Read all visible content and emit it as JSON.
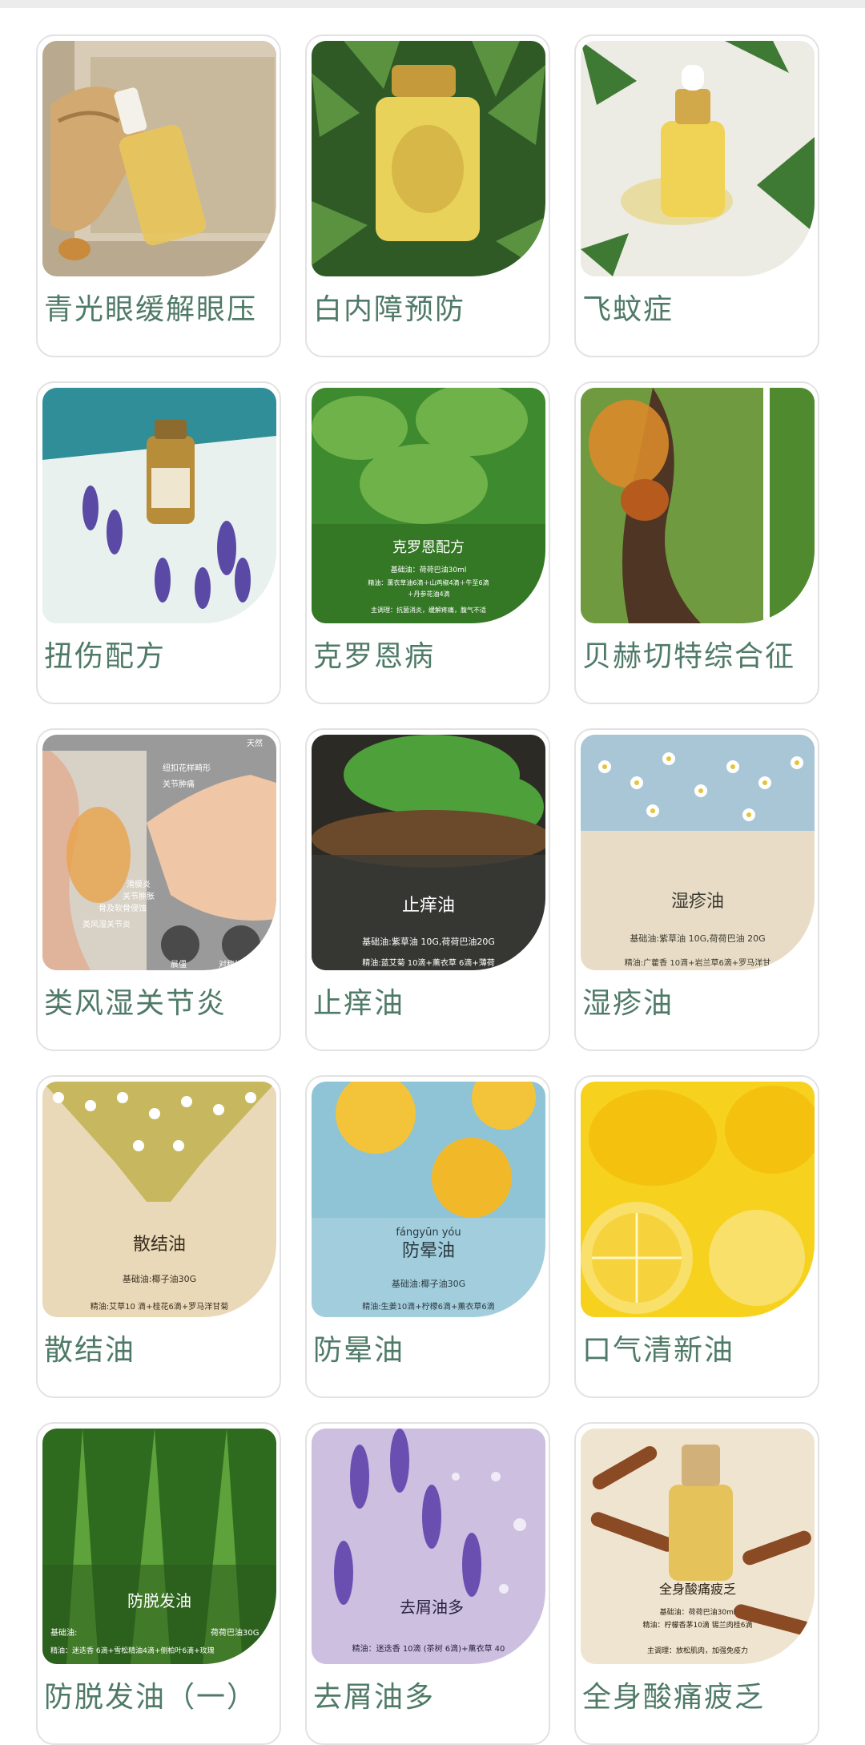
{
  "cards": [
    {
      "label": "青光眼缓解眼压",
      "icon": "ginger-oil-bottle"
    },
    {
      "label": "白内障预防",
      "icon": "gold-perfume-bottle"
    },
    {
      "label": "飞蚊症",
      "icon": "dropper-bottle"
    },
    {
      "label": "扭伤配方",
      "icon": "lavender-bottle"
    },
    {
      "label": "克罗恩病",
      "icon": "mint-leaves",
      "overlay_title": "克罗恩配方",
      "overlay_lines": [
        "基础油：荷荷巴油30ml",
        "精油：薰衣草油6滴＋山鸡椒4滴＋牛至6滴",
        "＋丹参花油4滴",
        "主调理：抗菌消炎，缓解疼痛，腹气不适"
      ]
    },
    {
      "label": "贝赫切特综合征",
      "icon": "tree-resin"
    },
    {
      "label": "类风湿关节炎",
      "icon": "joint-diagram",
      "overlay_lines": [
        "纽扣花样畸形",
        "关节肿痛",
        "滑膜炎",
        "关节肿胀",
        "骨及软骨侵蚀",
        "类风湿关节炎",
        "晨僵",
        "对称性关节",
        "天然"
      ]
    },
    {
      "label": "止痒油",
      "icon": "mint-bowl",
      "overlay_title": "止痒油",
      "overlay_lines": [
        "基础油:紫草油 10G,荷荷巴油20G",
        "精油:蓝艾菊 10滴+薰衣草 6滴+薄荷"
      ]
    },
    {
      "label": "湿疹油",
      "icon": "chamomile",
      "overlay_title": "湿疹油",
      "overlay_lines": [
        "基础油:紫草油 10G,荷荷巴油 20G",
        "精油:广藿香 10滴+岩兰草6滴+罗马洋甘"
      ]
    },
    {
      "label": "散结油",
      "icon": "chamomile-field",
      "overlay_title": "散结油",
      "overlay_lines": [
        "基础油:椰子油30G",
        "精油:艾草10 滴+桂花6滴+罗马洋甘菊"
      ]
    },
    {
      "label": "防晕油",
      "icon": "lemon-water",
      "overlay_pinyin": "fángyūn yóu",
      "overlay_title": "防晕油",
      "overlay_lines": [
        "基础油:椰子油30G",
        "精油:生姜10滴+柠檬6滴+薰衣草6滴"
      ]
    },
    {
      "label": "口气清新油",
      "icon": "lemons"
    },
    {
      "label": "防脱发油（一）",
      "icon": "grass",
      "overlay_title": "防脱发油",
      "overlay_lines": [
        "基础油:",
        "荷荷巴油30G",
        "精油：迷迭香 6滴+雪松精油4滴+侧柏叶6滴+玫瑰"
      ]
    },
    {
      "label": "去屑油多",
      "icon": "lavender",
      "overlay_title": "去屑油多",
      "overlay_lines": [
        "精油：迷迭香 10滴 (茶树 6滴)+薰衣草 40"
      ]
    },
    {
      "label": "全身酸痛疲乏",
      "icon": "cinnamon-bottle",
      "overlay_title": "全身酸痛疲乏",
      "overlay_lines": [
        "基础油：荷荷巴油30ml",
        "精油：柠檬香茅10滴 锡兰肉桂6滴",
        "主调理：放松肌肉，加强免疫力"
      ]
    }
  ]
}
